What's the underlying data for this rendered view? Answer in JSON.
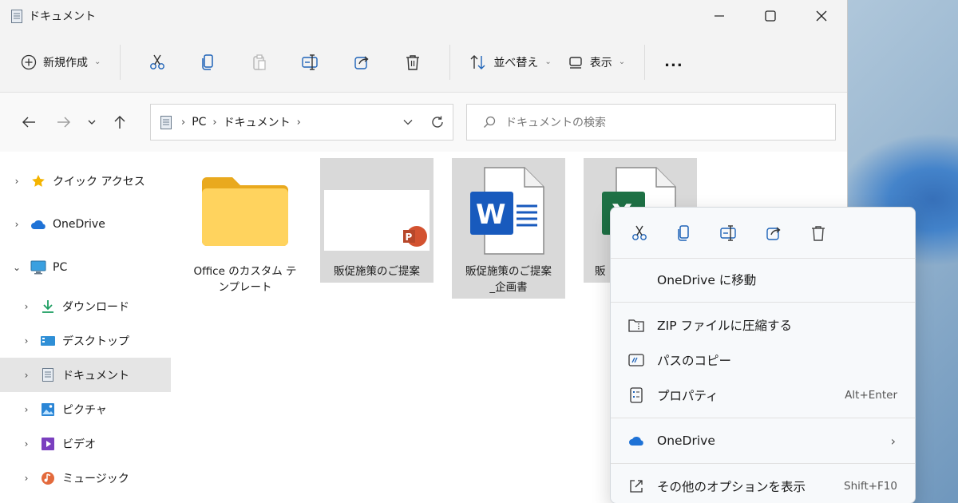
{
  "window": {
    "title": "ドキュメント"
  },
  "toolbar": {
    "new_label": "新規作成",
    "sort_label": "並べ替え",
    "view_label": "表示",
    "more_label": "..."
  },
  "address": {
    "crumbs": [
      "PC",
      "ドキュメント"
    ],
    "search_placeholder": "ドキュメントの検索"
  },
  "sidebar": {
    "items": [
      {
        "label": "クイック アクセス"
      },
      {
        "label": "OneDrive"
      },
      {
        "label": "PC"
      },
      {
        "label": "ダウンロード"
      },
      {
        "label": "デスクトップ"
      },
      {
        "label": "ドキュメント"
      },
      {
        "label": "ピクチャ"
      },
      {
        "label": "ビデオ"
      },
      {
        "label": "ミュージック"
      }
    ]
  },
  "files": [
    {
      "name_line1": "Office のカスタム テ",
      "name_line2": "ンプレート",
      "type": "folder"
    },
    {
      "name_line1": "販促施策のご提案",
      "name_line2": "",
      "type": "powerpoint"
    },
    {
      "name_line1": "販促施策のご提案",
      "name_line2": "_企画書",
      "type": "word"
    },
    {
      "name_line1": "販",
      "name_line2": "",
      "type": "excel"
    }
  ],
  "context_menu": {
    "items": [
      {
        "label": "OneDrive に移動",
        "accel": ""
      },
      {
        "label": "ZIP ファイルに圧縮する",
        "accel": ""
      },
      {
        "label": "パスのコピー",
        "accel": ""
      },
      {
        "label": "プロパティ",
        "accel": "Alt+Enter"
      },
      {
        "label": "OneDrive",
        "accel": ""
      },
      {
        "label": "その他のオプションを表示",
        "accel": "Shift+F10"
      }
    ]
  },
  "colors": {
    "accent_blue": "#1e63b8",
    "word_blue": "#185abd",
    "excel_green": "#1e7145",
    "powerpoint_orange": "#d35230",
    "folder_yellow": "#ffd35e"
  }
}
